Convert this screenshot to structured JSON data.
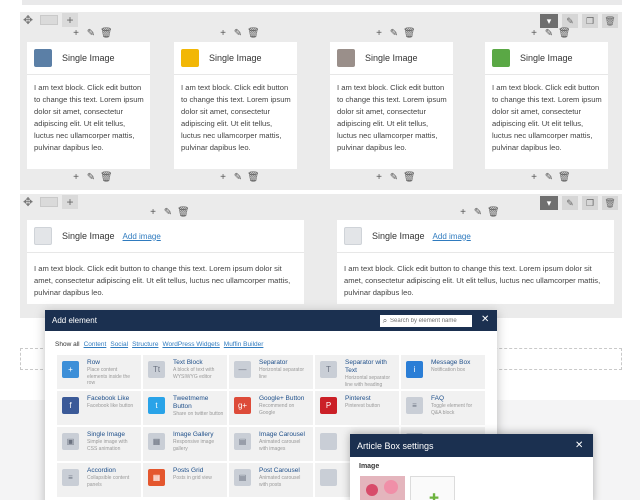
{
  "builder": {
    "upper_columns": [
      {
        "title": "Single Image",
        "thumb_color": "#5b7fa6",
        "text": "I am text block. Click edit button to change this text. Lorem ipsum dolor sit amet, consectetur adipiscing elit. Ut elit tellus, luctus nec ullamcorper mattis, pulvinar dapibus leo."
      },
      {
        "title": "Single Image",
        "thumb_color": "#f2b705",
        "text": "I am text block. Click edit button to change this text. Lorem ipsum dolor sit amet, consectetur adipiscing elit. Ut elit tellus, luctus nec ullamcorper mattis, pulvinar dapibus leo."
      },
      {
        "title": "Single Image",
        "thumb_color": "#9a8f8a",
        "text": "I am text block. Click edit button to change this text. Lorem ipsum dolor sit amet, consectetur adipiscing elit. Ut elit tellus, luctus nec ullamcorper mattis, pulvinar dapibus leo."
      },
      {
        "title": "Single Image",
        "thumb_color": "#5aa845",
        "text": "I am text block. Click edit button to change this text. Lorem ipsum dolor sit amet, consectetur adipiscing elit. Ut elit tellus, luctus nec ullamcorper mattis, pulvinar dapibus leo."
      }
    ],
    "lower_columns": [
      {
        "title": "Single Image",
        "add_image": "Add image",
        "text": "I am text block. Click edit button to change this text. Lorem ipsum dolor sit amet, consectetur adipiscing elit. Ut elit tellus, luctus nec ullamcorper mattis, pulvinar dapibus leo."
      },
      {
        "title": "Single Image",
        "add_image": "Add image",
        "text": "I am text block. Click edit button to change this text. Lorem ipsum dolor sit amet, consectetur adipiscing elit. Ut elit tellus, luctus nec ullamcorper mattis, pulvinar dapibus leo."
      }
    ],
    "icons": {
      "move": "move-icon",
      "add": "plus-icon",
      "edit": "pencil-icon",
      "delete": "trash-icon",
      "clone": "clone-icon",
      "dropdown": "chevron-down-icon"
    }
  },
  "add_element": {
    "title": "Add element",
    "search_placeholder": "Search by element name",
    "categories": [
      "Show all",
      "Content",
      "Social",
      "Structure",
      "WordPress Widgets",
      "Muffin Builder"
    ],
    "elements": [
      {
        "name": "Row",
        "desc": "Place content elements inside the row",
        "icon_color": "#3d8fd8",
        "glyph": "+"
      },
      {
        "name": "Text Block",
        "desc": "A block of text with WYSIWYG editor",
        "icon_color": "#c9ced6",
        "glyph": "Tt"
      },
      {
        "name": "Separator",
        "desc": "Horizontal separator line",
        "icon_color": "#c9ced6",
        "glyph": "—"
      },
      {
        "name": "Separator with Text",
        "desc": "Horizontal separator line with heading",
        "icon_color": "#c9ced6",
        "glyph": "T"
      },
      {
        "name": "Message Box",
        "desc": "Notification box",
        "icon_color": "#2b7ed6",
        "glyph": "i"
      },
      {
        "name": "Facebook Like",
        "desc": "Facebook like button",
        "icon_color": "#3b5a98",
        "glyph": "f"
      },
      {
        "name": "Tweetmeme Button",
        "desc": "Share on twitter button",
        "icon_color": "#29a3e8",
        "glyph": "t"
      },
      {
        "name": "Google+ Button",
        "desc": "Recommend on Google",
        "icon_color": "#dd4b39",
        "glyph": "g+"
      },
      {
        "name": "Pinterest",
        "desc": "Pinterest button",
        "icon_color": "#cb2027",
        "glyph": "P"
      },
      {
        "name": "FAQ",
        "desc": "Toggle element for Q&A block",
        "icon_color": "#c9ced6",
        "glyph": "≡"
      },
      {
        "name": "Single Image",
        "desc": "Simple image with CSS animation",
        "icon_color": "#c9ced6",
        "glyph": "▣"
      },
      {
        "name": "Image Gallery",
        "desc": "Responsive image gallery",
        "icon_color": "#c9ced6",
        "glyph": "▦"
      },
      {
        "name": "Image Carousel",
        "desc": "Animated carousel with images",
        "icon_color": "#c9ced6",
        "glyph": "▤"
      },
      {
        "name": "",
        "desc": "",
        "icon_color": "#c9ced6",
        "glyph": ""
      },
      {
        "name": "",
        "desc": "",
        "icon_color": "#c9ced6",
        "glyph": ""
      },
      {
        "name": "Accordion",
        "desc": "Collapsible content panels",
        "icon_color": "#c9ced6",
        "glyph": "≡"
      },
      {
        "name": "Posts Grid",
        "desc": "Posts in grid view",
        "icon_color": "#e4572e",
        "glyph": "▦"
      },
      {
        "name": "Post Carousel",
        "desc": "Animated carousel with posts",
        "icon_color": "#c9ced6",
        "glyph": "▤"
      },
      {
        "name": "",
        "desc": "",
        "icon_color": "#c9ced6",
        "glyph": ""
      },
      {
        "name": "",
        "desc": "",
        "icon_color": "#c9ced6",
        "glyph": ""
      }
    ]
  },
  "settings": {
    "title": "Article Box settings",
    "image_label": "Image"
  }
}
